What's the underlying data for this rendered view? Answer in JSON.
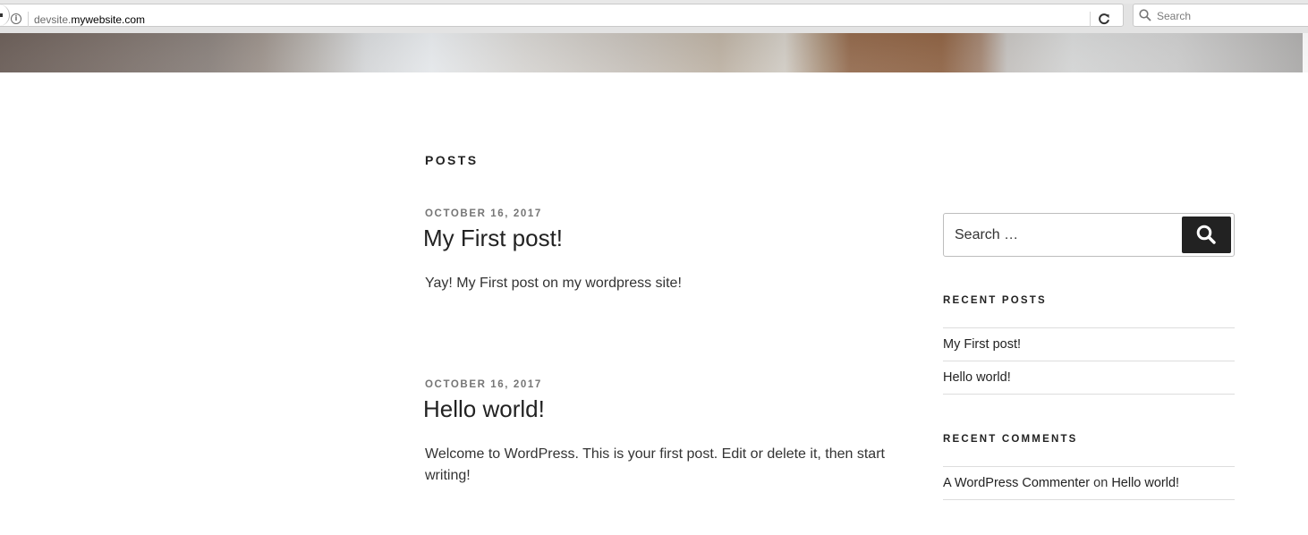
{
  "browser": {
    "url_prefix": "devsite.",
    "url_host": "mywebsite.com",
    "search_placeholder": "Search"
  },
  "main": {
    "heading": "POSTS",
    "posts": [
      {
        "date": "OCTOBER 16, 2017",
        "title": "My First post!",
        "excerpt": "Yay! My First post on my wordpress site!"
      },
      {
        "date": "OCTOBER 16, 2017",
        "title": "Hello world!",
        "excerpt": "Welcome to WordPress. This is your first post. Edit or delete it, then start writing!"
      }
    ]
  },
  "sidebar": {
    "search_placeholder": "Search …",
    "recent_posts": {
      "title": "RECENT POSTS",
      "items": [
        "My First post!",
        "Hello world!"
      ]
    },
    "recent_comments": {
      "title": "RECENT COMMENTS",
      "items": [
        {
          "author": "A WordPress Commenter",
          "on": "on",
          "post": "Hello world!"
        }
      ]
    }
  },
  "colors": {
    "text": "#222222",
    "meta": "#767676",
    "button_bg": "#222222",
    "divider": "#dddddd"
  }
}
